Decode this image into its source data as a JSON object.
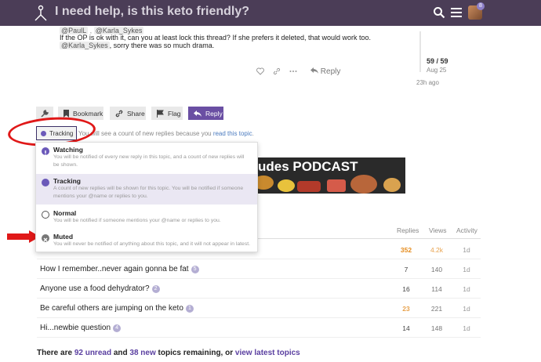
{
  "header": {
    "title": "I need help, is this keto friendly?",
    "notification_count": "8"
  },
  "post": {
    "mention_1": "@PaulL",
    "mention_2": "@Karla_Sykes",
    "line_1": "If the OP is ok with it, can you at least lock this thread? If she prefers it deleted, that would work too.",
    "mention_3": "@Karla_Sykes",
    "line_2_rest": ", sorry there was so much drama.",
    "reply_label": "Reply"
  },
  "timeline": {
    "position": "59 / 59",
    "date": "Aug 25",
    "ago": "23h ago"
  },
  "toolbar": {
    "bookmark": "Bookmark",
    "share": "Share",
    "flag": "Flag",
    "reply": "Reply"
  },
  "tracking": {
    "button_label": "Tracking",
    "desc_prefix": "You will see a count of new replies because you ",
    "desc_link": "read this topic",
    "desc_suffix": "."
  },
  "notification_menu": {
    "options": [
      {
        "title": "Watching",
        "desc": "You will be notified of every new reply in this topic, and a count of new replies will be shown."
      },
      {
        "title": "Tracking",
        "desc": "A count of new replies will be shown for this topic. You will be notified if someone mentions your @name or replies to you."
      },
      {
        "title": "Normal",
        "desc": "You will be notified if someone mentions your @name or replies to you."
      },
      {
        "title": "Muted",
        "desc": "You will never be notified of anything about this topic, and it will not appear in latest."
      }
    ]
  },
  "banner": {
    "text": "udes PODCAST"
  },
  "table": {
    "headers": {
      "replies": "Replies",
      "views": "Views",
      "activity": "Activity"
    },
    "rows": [
      {
        "title": "How I remember..never again gonna be fat",
        "badge": "5",
        "replies": "7",
        "views": "140",
        "activity": "1d"
      },
      {
        "title": "Anyone use a food dehydrator?",
        "badge": "2",
        "replies": "16",
        "views": "114",
        "activity": "1d"
      },
      {
        "title": "Be careful others are jumping on the keto",
        "badge": "1",
        "replies": "23",
        "views": "221",
        "activity": "1d"
      },
      {
        "title": "Hi...newbie question",
        "badge": "4",
        "replies": "14",
        "views": "148",
        "activity": "1d"
      }
    ],
    "partial_row": {
      "replies": "352",
      "views": "4.2k",
      "activity": "1d"
    }
  },
  "footer": {
    "prefix": "There are ",
    "unread": "92 unread",
    "middle": " and ",
    "new": "38 new",
    "suffix": " topics remaining, or ",
    "latest": "view latest topics"
  }
}
